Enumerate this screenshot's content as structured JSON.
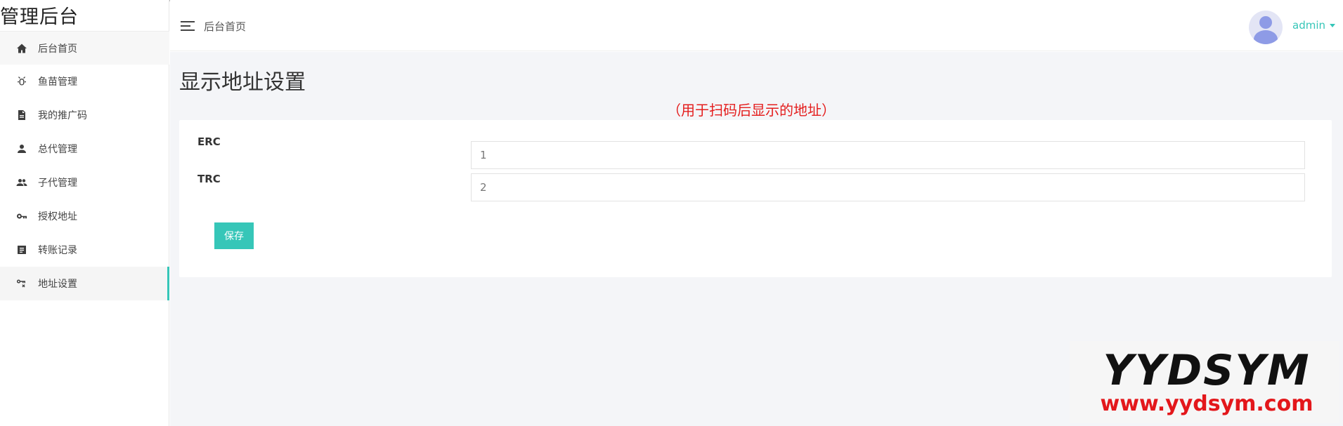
{
  "brand": {
    "title": "管理后台"
  },
  "sidebar": {
    "items": [
      {
        "label": "后台首页",
        "icon": "home-icon"
      },
      {
        "label": "鱼苗管理",
        "icon": "bug-icon"
      },
      {
        "label": "我的推广码",
        "icon": "document-icon"
      },
      {
        "label": "总代管理",
        "icon": "person-icon"
      },
      {
        "label": "子代管理",
        "icon": "people-icon"
      },
      {
        "label": "授权地址",
        "icon": "key-icon"
      },
      {
        "label": "转账记录",
        "icon": "list-icon"
      },
      {
        "label": "地址设置",
        "icon": "key-settings-icon",
        "active": true
      }
    ]
  },
  "header": {
    "breadcrumb": "后台首页",
    "user": "admin"
  },
  "main": {
    "page_title": "显示地址设置",
    "note": "（用于扫码后显示的地址）",
    "fields": [
      {
        "label": "ERC",
        "value": "1"
      },
      {
        "label": "TRC",
        "value": "2"
      }
    ],
    "save_label": "保存"
  },
  "watermark": {
    "line1": "YYDSYM",
    "line2": "www.yydsym.com"
  },
  "colors": {
    "accent": "#36c6b8",
    "note": "#e41e1e",
    "background": "#f4f5f8"
  }
}
